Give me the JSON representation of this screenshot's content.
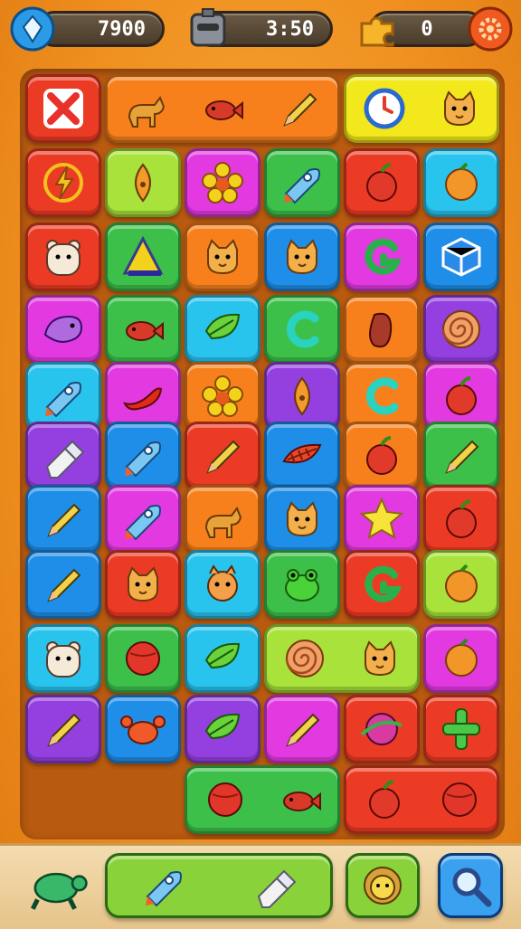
{
  "hud": {
    "score": "7900",
    "timer": "3:50",
    "stars": "0"
  },
  "colors": {
    "red": "#ec3b24",
    "orange": "#f7801c",
    "yellow": "#f3e81c",
    "lime": "#a8e23a",
    "green": "#3cc04a",
    "blue": "#1f8ee8",
    "cyan": "#29c4ee",
    "purple": "#9440e0",
    "magenta": "#e23ae0",
    "board": "#b85a10"
  },
  "board": {
    "tiles": [
      {
        "name": "close-tile",
        "color": "red",
        "icons": [
          "close-icon"
        ]
      },
      {
        "name": "dog-fish-pencil-tile",
        "color": "orange",
        "icons": [
          "dog-icon",
          "fish-icon",
          "pencil-icon"
        ]
      },
      {
        "name": "clock-cat-tile",
        "color": "yellow",
        "icons": [
          "clock-icon",
          "cat-icon"
        ]
      },
      {
        "name": "tile-r2c1",
        "color": "red",
        "icons": [
          "bolt-icon"
        ]
      },
      {
        "name": "tile-r2c2",
        "color": "lime",
        "icons": [
          "leaf-drop-icon"
        ]
      },
      {
        "name": "tile-r2c3",
        "color": "magenta",
        "icons": [
          "flower-icon"
        ]
      },
      {
        "name": "tile-r2c4",
        "color": "green",
        "icons": [
          "rocket-icon"
        ]
      },
      {
        "name": "tile-r2c5",
        "color": "red",
        "icons": [
          "apple-icon"
        ]
      },
      {
        "name": "tile-r2c6",
        "color": "cyan",
        "icons": [
          "orange-fruit-icon"
        ]
      },
      {
        "name": "tile-r3c1",
        "color": "red",
        "icons": [
          "bear-icon"
        ]
      },
      {
        "name": "tile-r3c2",
        "color": "green",
        "icons": [
          "triangle-icon"
        ]
      },
      {
        "name": "tile-r3c3",
        "color": "orange",
        "icons": [
          "cat-icon"
        ]
      },
      {
        "name": "tile-r3c4",
        "color": "blue",
        "icons": [
          "cat-icon"
        ]
      },
      {
        "name": "tile-r3c5",
        "color": "magenta",
        "icons": [
          "letter-g-icon"
        ]
      },
      {
        "name": "tile-r3c6",
        "color": "blue",
        "icons": [
          "cube-icon"
        ]
      },
      {
        "name": "tile-r4c1",
        "color": "magenta",
        "icons": [
          "whale-icon"
        ]
      },
      {
        "name": "tile-r4c2",
        "color": "green",
        "icons": [
          "fish-icon"
        ]
      },
      {
        "name": "tile-r4c3",
        "color": "cyan",
        "icons": [
          "leaf-icon"
        ]
      },
      {
        "name": "tile-r4c4",
        "color": "green",
        "icons": [
          "letter-c-icon"
        ]
      },
      {
        "name": "tile-r4c5",
        "color": "orange",
        "icons": [
          "bean-icon"
        ]
      },
      {
        "name": "tile-r4c6",
        "color": "purple",
        "icons": [
          "spiral-icon"
        ]
      },
      {
        "name": "tile-r5c1",
        "color": "cyan",
        "icons": [
          "rocket-icon"
        ]
      },
      {
        "name": "tile-r5c2",
        "color": "magenta",
        "icons": [
          "chili-icon"
        ]
      },
      {
        "name": "tile-r5c3",
        "color": "orange",
        "icons": [
          "flower-icon"
        ]
      },
      {
        "name": "tile-r5c4",
        "color": "purple",
        "icons": [
          "leaf-drop-icon"
        ]
      },
      {
        "name": "tile-r5c5",
        "color": "orange",
        "icons": [
          "letter-c-icon"
        ]
      },
      {
        "name": "tile-r5c6",
        "color": "magenta",
        "icons": [
          "apple-icon"
        ]
      },
      {
        "name": "tile-r6c1",
        "color": "purple",
        "icons": [
          "eraser-icon"
        ]
      },
      {
        "name": "tile-r6c2",
        "color": "blue",
        "icons": [
          "rocket-icon"
        ]
      },
      {
        "name": "tile-r6c3",
        "color": "red",
        "icons": [
          "pencil-icon"
        ]
      },
      {
        "name": "tile-r6c4",
        "color": "blue",
        "icons": [
          "feather-icon"
        ]
      },
      {
        "name": "tile-r6c5",
        "color": "orange",
        "icons": [
          "apple-icon"
        ]
      },
      {
        "name": "tile-r6c6",
        "color": "green",
        "icons": [
          "pencil-icon"
        ]
      },
      {
        "name": "tile-r7c1",
        "color": "blue",
        "icons": [
          "pencil-icon"
        ]
      },
      {
        "name": "tile-r7c2",
        "color": "magenta",
        "icons": [
          "rocket-icon"
        ]
      },
      {
        "name": "tile-r7c3",
        "color": "orange",
        "icons": [
          "dog-icon"
        ]
      },
      {
        "name": "tile-r7c4",
        "color": "blue",
        "icons": [
          "cat-icon"
        ]
      },
      {
        "name": "tile-r7c5",
        "color": "magenta",
        "icons": [
          "star-icon"
        ]
      },
      {
        "name": "tile-r7c6",
        "color": "red",
        "icons": [
          "apple-icon"
        ]
      },
      {
        "name": "tile-r8c1",
        "color": "blue",
        "icons": [
          "pencil-icon"
        ]
      },
      {
        "name": "tile-r8c2",
        "color": "red",
        "icons": [
          "cat-icon"
        ]
      },
      {
        "name": "tile-r8c3",
        "color": "cyan",
        "icons": [
          "squirrel-icon"
        ]
      },
      {
        "name": "tile-r8c4",
        "color": "green",
        "icons": [
          "frog-icon"
        ]
      },
      {
        "name": "tile-r8c5",
        "color": "red",
        "icons": [
          "letter-g-icon"
        ]
      },
      {
        "name": "tile-r8c6",
        "color": "lime",
        "icons": [
          "orange-fruit-icon"
        ]
      },
      {
        "name": "tile-r9c1",
        "color": "cyan",
        "icons": [
          "bear-icon"
        ]
      },
      {
        "name": "tile-r9c2",
        "color": "green",
        "icons": [
          "ball-icon"
        ]
      },
      {
        "name": "tile-r9c3",
        "color": "cyan",
        "icons": [
          "leaf-icon"
        ]
      },
      {
        "name": "tile-r9c45",
        "color": "lime",
        "icons": [
          "spiral-icon",
          "cat-icon"
        ]
      },
      {
        "name": "tile-r9c6",
        "color": "magenta",
        "icons": [
          "orange-fruit-icon"
        ]
      },
      {
        "name": "tile-r10c1",
        "color": "purple",
        "icons": [
          "pencil-icon"
        ]
      },
      {
        "name": "tile-r10c2",
        "color": "blue",
        "icons": [
          "crab-icon"
        ]
      },
      {
        "name": "tile-r10c3",
        "color": "purple",
        "icons": [
          "leaf-icon"
        ]
      },
      {
        "name": "tile-r10c4",
        "color": "magenta",
        "icons": [
          "pencil-icon"
        ]
      },
      {
        "name": "tile-r10c5",
        "color": "red",
        "icons": [
          "planet-icon"
        ]
      },
      {
        "name": "tile-r10c6",
        "color": "red",
        "icons": [
          "plus-pipe-icon"
        ]
      },
      {
        "name": "tile-r11c34",
        "color": "green",
        "icons": [
          "ball-icon",
          "fish-icon"
        ]
      },
      {
        "name": "tile-r11c56",
        "color": "red",
        "icons": [
          "apple-icon",
          "ball-icon"
        ]
      }
    ]
  },
  "toolbar": {
    "buttons": [
      {
        "name": "turtle-button",
        "icons": [
          "turtle-icon"
        ]
      },
      {
        "name": "rocket-eraser-button",
        "icons": [
          "rocket-icon",
          "eraser-icon"
        ]
      },
      {
        "name": "lion-button",
        "icons": [
          "lion-icon"
        ]
      },
      {
        "name": "search-button",
        "icons": [
          "search-icon"
        ]
      }
    ]
  }
}
